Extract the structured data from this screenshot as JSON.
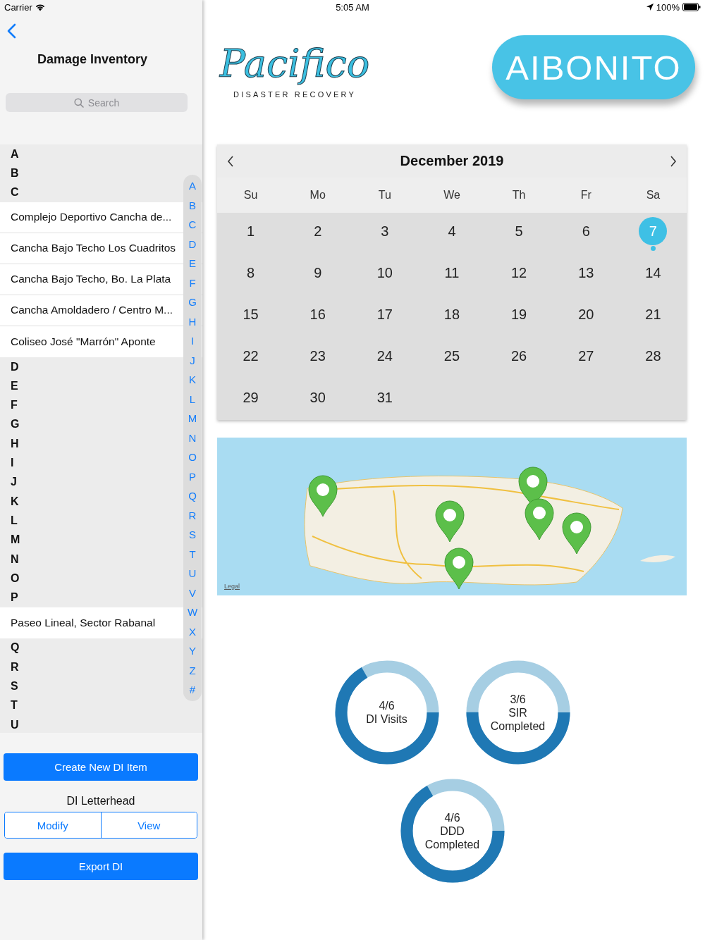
{
  "status_bar": {
    "carrier": "Carrier",
    "time": "5:05 AM",
    "battery": "100%"
  },
  "sidebar": {
    "title": "Damage Inventory",
    "search": {
      "placeholder": "Search"
    },
    "sections": [
      {
        "letter": "A"
      },
      {
        "letter": "B"
      },
      {
        "letter": "C",
        "items": [
          "Complejo Deportivo Cancha de...",
          "Cancha Bajo Techo Los Cuadritos",
          "Cancha Bajo Techo, Bo. La Plata",
          "Cancha Amoldadero / Centro M...",
          "Coliseo José \"Marrón\" Aponte"
        ]
      },
      {
        "letter": "D"
      },
      {
        "letter": "E"
      },
      {
        "letter": "F"
      },
      {
        "letter": "G"
      },
      {
        "letter": "H"
      },
      {
        "letter": "I"
      },
      {
        "letter": "J"
      },
      {
        "letter": "K"
      },
      {
        "letter": "L"
      },
      {
        "letter": "M"
      },
      {
        "letter": "N"
      },
      {
        "letter": "O"
      },
      {
        "letter": "P",
        "items": [
          "Paseo Lineal, Sector Rabanal"
        ]
      },
      {
        "letter": "Q"
      },
      {
        "letter": "R"
      },
      {
        "letter": "S"
      },
      {
        "letter": "T"
      },
      {
        "letter": "U"
      }
    ],
    "index": [
      "A",
      "B",
      "C",
      "D",
      "E",
      "F",
      "G",
      "H",
      "I",
      "J",
      "K",
      "L",
      "M",
      "N",
      "O",
      "P",
      "Q",
      "R",
      "S",
      "T",
      "U",
      "V",
      "W",
      "X",
      "Y",
      "Z",
      "#"
    ],
    "create_button": "Create New DI Item",
    "letterhead": {
      "label": "DI Letterhead",
      "segments": [
        "Modify",
        "View"
      ]
    },
    "export_button": "Export DI"
  },
  "header": {
    "logo": {
      "name": "Pacifico",
      "tagline": "DISASTER RECOVERY"
    },
    "location": "AIBONITO"
  },
  "calendar": {
    "month": "December 2019",
    "weekdays": [
      "Su",
      "Mo",
      "Tu",
      "We",
      "Th",
      "Fr",
      "Sa"
    ],
    "days": [
      {
        "day": "1",
        "selected": false,
        "event": false
      },
      {
        "day": "2",
        "selected": false,
        "event": false
      },
      {
        "day": "3",
        "selected": false,
        "event": false
      },
      {
        "day": "4",
        "selected": false,
        "event": false
      },
      {
        "day": "5",
        "selected": false,
        "event": false
      },
      {
        "day": "6",
        "selected": false,
        "event": false
      },
      {
        "day": "7",
        "selected": true,
        "event": true
      },
      {
        "day": "8",
        "selected": false,
        "event": false
      },
      {
        "day": "9",
        "selected": false,
        "event": false
      },
      {
        "day": "10",
        "selected": false,
        "event": false
      },
      {
        "day": "11",
        "selected": false,
        "event": false
      },
      {
        "day": "12",
        "selected": false,
        "event": false
      },
      {
        "day": "13",
        "selected": false,
        "event": false
      },
      {
        "day": "14",
        "selected": false,
        "event": false
      },
      {
        "day": "15",
        "selected": false,
        "event": false
      },
      {
        "day": "16",
        "selected": false,
        "event": false
      },
      {
        "day": "17",
        "selected": false,
        "event": false
      },
      {
        "day": "18",
        "selected": false,
        "event": false
      },
      {
        "day": "19",
        "selected": false,
        "event": false
      },
      {
        "day": "20",
        "selected": false,
        "event": false
      },
      {
        "day": "21",
        "selected": false,
        "event": false
      },
      {
        "day": "22",
        "selected": false,
        "event": false
      },
      {
        "day": "23",
        "selected": false,
        "event": false
      },
      {
        "day": "24",
        "selected": false,
        "event": false
      },
      {
        "day": "25",
        "selected": false,
        "event": false
      },
      {
        "day": "26",
        "selected": false,
        "event": false
      },
      {
        "day": "27",
        "selected": false,
        "event": false
      },
      {
        "day": "28",
        "selected": false,
        "event": false
      },
      {
        "day": "29",
        "selected": false,
        "event": false
      },
      {
        "day": "30",
        "selected": false,
        "event": false
      },
      {
        "day": "31",
        "selected": false,
        "event": false
      }
    ]
  },
  "map": {
    "legal": "Legal"
  },
  "progress": [
    {
      "lines": [
        "4/6",
        "DI Visits"
      ],
      "level": 0.667
    },
    {
      "lines": [
        "3/6",
        "SIR",
        "Completed"
      ],
      "level": 0.5
    },
    {
      "lines": [
        "4/6",
        "DDD",
        "Completed"
      ],
      "level": 0.667
    }
  ]
}
